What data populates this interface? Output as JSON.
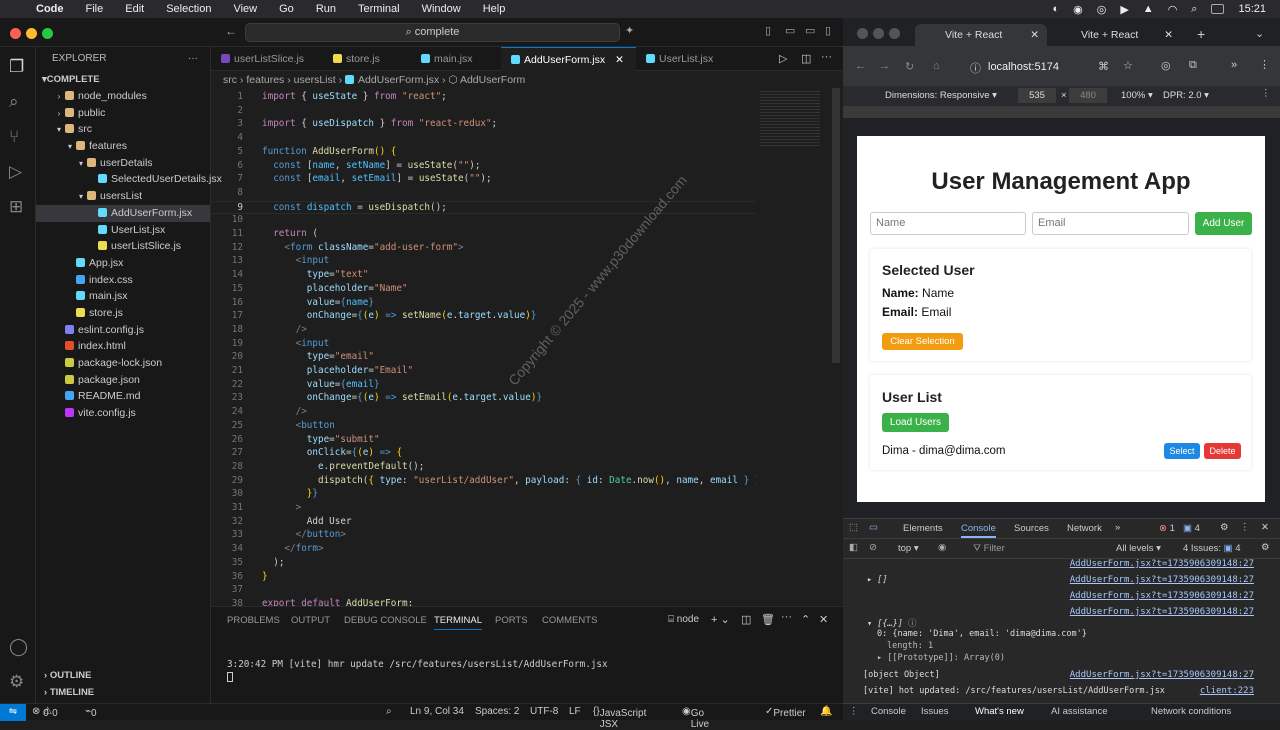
{
  "macos_menu": {
    "app": "Code",
    "items": [
      "File",
      "Edit",
      "Selection",
      "View",
      "Go",
      "Run",
      "Terminal",
      "Window",
      "Help"
    ],
    "clock": "15:21"
  },
  "vscode": {
    "command_center": "complete",
    "explorer": {
      "title": "EXPLORER",
      "root": "COMPLETE",
      "items": [
        {
          "label": "node_modules",
          "depth": 1,
          "kind": "folder",
          "open": false
        },
        {
          "label": "public",
          "depth": 1,
          "kind": "folder",
          "open": false
        },
        {
          "label": "src",
          "depth": 1,
          "kind": "folder",
          "open": true
        },
        {
          "label": "features",
          "depth": 2,
          "kind": "folder",
          "open": true
        },
        {
          "label": "userDetails",
          "depth": 3,
          "kind": "folder",
          "open": true
        },
        {
          "label": "SelectedUserDetails.jsx",
          "depth": 4,
          "kind": "jsx"
        },
        {
          "label": "usersList",
          "depth": 3,
          "kind": "folder",
          "open": true
        },
        {
          "label": "AddUserForm.jsx",
          "depth": 4,
          "kind": "jsx",
          "selected": true
        },
        {
          "label": "UserList.jsx",
          "depth": 4,
          "kind": "jsx"
        },
        {
          "label": "userListSlice.js",
          "depth": 4,
          "kind": "js"
        },
        {
          "label": "App.jsx",
          "depth": 2,
          "kind": "jsx"
        },
        {
          "label": "index.css",
          "depth": 2,
          "kind": "css"
        },
        {
          "label": "main.jsx",
          "depth": 2,
          "kind": "jsx"
        },
        {
          "label": "store.js",
          "depth": 2,
          "kind": "js"
        },
        {
          "label": "eslint.config.js",
          "depth": 1,
          "kind": "eslint"
        },
        {
          "label": "index.html",
          "depth": 1,
          "kind": "html"
        },
        {
          "label": "package-lock.json",
          "depth": 1,
          "kind": "json"
        },
        {
          "label": "package.json",
          "depth": 1,
          "kind": "json"
        },
        {
          "label": "README.md",
          "depth": 1,
          "kind": "md"
        },
        {
          "label": "vite.config.js",
          "depth": 1,
          "kind": "vite"
        }
      ],
      "outline": "OUTLINE",
      "timeline": "TIMELINE"
    },
    "tabs": [
      "userListSlice.js",
      "store.js",
      "main.jsx",
      "AddUserForm.jsx",
      "UserList.jsx"
    ],
    "active_tab": "AddUserForm.jsx",
    "breadcrumb": [
      "src",
      "features",
      "usersList",
      "AddUserForm.jsx",
      "AddUserForm"
    ],
    "watermark": "Copyright © 2025 - www.p30download.com",
    "code_lines": [
      {
        "n": "1",
        "html": "<span class='k'>import</span> <span class='w'>{ </span><span class='v'>useState</span><span class='w'> } </span><span class='k'>from</span> <span class='s'>\"react\"</span><span class='w'>;</span>"
      },
      {
        "n": "2",
        "html": ""
      },
      {
        "n": "3",
        "html": "<span class='k'>import</span> <span class='w'>{ </span><span class='v'>useDispatch</span><span class='w'> } </span><span class='k'>from</span> <span class='s'>\"react-redux\"</span><span class='w'>;</span>"
      },
      {
        "n": "4",
        "html": ""
      },
      {
        "n": "5",
        "html": "<span class='b'>function</span> <span class='f'>AddUserForm</span><span class='y'>()</span> <span class='y'>{</span>"
      },
      {
        "n": "6",
        "html": "  <span class='b'>const</span> <span class='c'>[</span><span class='n'>name</span><span class='w'>, </span><span class='n'>setName</span><span class='c'>]</span> <span class='w'>= </span><span class='f'>useState</span><span class='c'>(</span><span class='s'>\"\"</span><span class='c'>)</span><span class='w'>;</span>"
      },
      {
        "n": "7",
        "html": "  <span class='b'>const</span> <span class='c'>[</span><span class='n'>email</span><span class='w'>, </span><span class='n'>setEmail</span><span class='c'>]</span> <span class='w'>= </span><span class='f'>useState</span><span class='c'>(</span><span class='s'>\"\"</span><span class='c'>)</span><span class='w'>;</span>"
      },
      {
        "n": "8",
        "html": ""
      },
      {
        "n": "9",
        "html": "  <span class='b'>const</span> <span class='n'>dispatch</span> <span class='w'>= </span><span class='f'>useDispatch</span><span class='c'>()</span><span class='w'>;</span>"
      },
      {
        "n": "10",
        "html": ""
      },
      {
        "n": "11",
        "html": "  <span class='k'>return</span> <span class='c'>(</span>"
      },
      {
        "n": "12",
        "html": "    <span class='g'>&lt;</span><span class='b'>form</span> <span class='v'>className</span><span class='w'>=</span><span class='s'>\"add-user-form\"</span><span class='g'>&gt;</span>"
      },
      {
        "n": "13",
        "html": "      <span class='g'>&lt;</span><span class='b'>input</span>"
      },
      {
        "n": "14",
        "html": "        <span class='v'>type</span><span class='w'>=</span><span class='s'>\"text\"</span>"
      },
      {
        "n": "15",
        "html": "        <span class='v'>placeholder</span><span class='w'>=</span><span class='s'>\"Name\"</span>"
      },
      {
        "n": "16",
        "html": "        <span class='v'>value</span><span class='w'>=</span><span class='b'>{</span><span class='n'>name</span><span class='b'>}</span>"
      },
      {
        "n": "17",
        "html": "        <span class='v'>onChange</span><span class='w'>=</span><span class='b'>{</span><span class='y'>(</span><span class='v'>e</span><span class='y'>)</span> <span class='b'>=&gt;</span> <span class='f'>setName</span><span class='y'>(</span><span class='v'>e</span><span class='w'>.</span><span class='v'>target</span><span class='w'>.</span><span class='v'>value</span><span class='y'>)</span><span class='b'>}</span>"
      },
      {
        "n": "18",
        "html": "      <span class='g'>/&gt;</span>"
      },
      {
        "n": "19",
        "html": "      <span class='g'>&lt;</span><span class='b'>input</span>"
      },
      {
        "n": "20",
        "html": "        <span class='v'>type</span><span class='w'>=</span><span class='s'>\"email\"</span>"
      },
      {
        "n": "21",
        "html": "        <span class='v'>placeholder</span><span class='w'>=</span><span class='s'>\"Email\"</span>"
      },
      {
        "n": "22",
        "html": "        <span class='v'>value</span><span class='w'>=</span><span class='b'>{</span><span class='n'>email</span><span class='b'>}</span>"
      },
      {
        "n": "23",
        "html": "        <span class='v'>onChange</span><span class='w'>=</span><span class='b'>{</span><span class='y'>(</span><span class='v'>e</span><span class='y'>)</span> <span class='b'>=&gt;</span> <span class='f'>setEmail</span><span class='y'>(</span><span class='v'>e</span><span class='w'>.</span><span class='v'>target</span><span class='w'>.</span><span class='v'>value</span><span class='y'>)</span><span class='b'>}</span>"
      },
      {
        "n": "24",
        "html": "      <span class='g'>/&gt;</span>"
      },
      {
        "n": "25",
        "html": "      <span class='g'>&lt;</span><span class='b'>button</span>"
      },
      {
        "n": "26",
        "html": "        <span class='v'>type</span><span class='w'>=</span><span class='s'>\"submit\"</span>"
      },
      {
        "n": "27",
        "html": "        <span class='v'>onClick</span><span class='w'>=</span><span class='b'>{</span><span class='y'>(</span><span class='v'>e</span><span class='y'>)</span> <span class='b'>=&gt;</span> <span class='y'>{</span>"
      },
      {
        "n": "28",
        "html": "          <span class='v'>e</span><span class='w'>.</span><span class='f'>preventDefault</span><span class='c'>()</span><span class='w'>;</span>"
      },
      {
        "n": "29",
        "html": "          <span class='f'>dispatch</span><span class='c'>(</span><span class='y'>{</span> <span class='v'>type</span><span class='w'>: </span><span class='s'>\"userList/addUser\"</span><span class='w'>, </span><span class='v'>payload</span><span class='w'>: </span><span class='b'>{</span> <span class='v'>id</span><span class='w'>: </span><span class='t'>Date</span><span class='w'>.</span><span class='f'>now</span><span class='y'>()</span><span class='w'>, </span><span class='v'>name</span><span class='w'>, </span><span class='v'>email</span> <span class='b'>}</span> <span class='y'>}</span><span class='c'>)</span><span class='w'>;</span>"
      },
      {
        "n": "30",
        "html": "        <span class='y'>}</span><span class='b'>}</span>"
      },
      {
        "n": "31",
        "html": "      <span class='g'>&gt;</span>"
      },
      {
        "n": "32",
        "html": "        <span class='w'>Add User</span>"
      },
      {
        "n": "33",
        "html": "      <span class='g'>&lt;/</span><span class='b'>button</span><span class='g'>&gt;</span>"
      },
      {
        "n": "34",
        "html": "    <span class='g'>&lt;/</span><span class='b'>form</span><span class='g'>&gt;</span>"
      },
      {
        "n": "35",
        "html": "  <span class='c'>)</span><span class='w'>;</span>"
      },
      {
        "n": "36",
        "html": "<span class='y'>}</span>"
      },
      {
        "n": "37",
        "html": ""
      },
      {
        "n": "38",
        "html": "<span class='k'>export</span> <span class='k'>default</span> <span class='f'>AddUserForm</span><span class='w'>;</span>"
      }
    ],
    "panel": {
      "tabs": [
        "PROBLEMS",
        "OUTPUT",
        "DEBUG CONSOLE",
        "TERMINAL",
        "PORTS",
        "COMMENTS"
      ],
      "active": "TERMINAL",
      "terminal_name": "node",
      "terminal_line": "3:20:42 PM [vite] hmr update /src/features/usersList/AddUserForm.jsx"
    },
    "status": {
      "errors": "0",
      "warnings": "0",
      "ports": "0",
      "position": "Ln 9, Col 34",
      "spaces": "Spaces: 2",
      "encoding": "UTF-8",
      "eol": "LF",
      "language": "JavaScript JSX",
      "golive": "Go Live",
      "prettier": "Prettier"
    }
  },
  "browser": {
    "tabs": [
      "Vite + React",
      "Vite + React"
    ],
    "url": "localhost:5174",
    "device": {
      "label": "Dimensions: Responsive",
      "width": "535",
      "height": "480",
      "zoom": "100%",
      "dpr": "DPR: 2.0"
    },
    "app": {
      "title": "User Management App",
      "name_placeholder": "Name",
      "email_placeholder": "Email",
      "add_button": "Add User",
      "selected": {
        "heading": "Selected User",
        "name_label": "Name:",
        "name_value": "Name",
        "email_label": "Email:",
        "email_value": "Email",
        "clear_button": "Clear Selection"
      },
      "list": {
        "heading": "User List",
        "load_button": "Load Users",
        "row": "Dima - dima@dima.com",
        "select_button": "Select",
        "delete_button": "Delete"
      }
    },
    "devtools": {
      "tabs": [
        "Elements",
        "Console",
        "Sources",
        "Network"
      ],
      "active": "Console",
      "errors": "1",
      "messages": "4",
      "context": "top",
      "filter": "Filter",
      "levels": "All levels",
      "issues": "4 Issues:",
      "issues_count": "4",
      "source_link": "AddUserForm.jsx?t=1735906309148:27",
      "array_empty": "[]",
      "array_open": "[{…}]",
      "item0": "0: {name: 'Dima', email: 'dima@dima.com'}",
      "length": "length: 1",
      "proto": "[[Prototype]]: Array(0)",
      "object_text": "[object Object]",
      "vite_msg": "[vite] hot updated: /src/features/usersList/AddUserForm.jsx",
      "client": "client:223",
      "drawer": [
        "Console",
        "Issues",
        "What's new",
        "AI assistance",
        "Network conditions"
      ]
    }
  }
}
